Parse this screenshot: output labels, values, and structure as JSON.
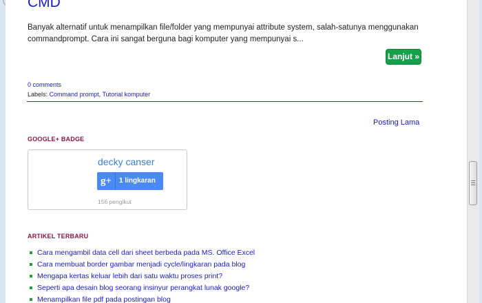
{
  "post": {
    "title": "CMD",
    "snippet": "Banyak alternatif untuk menampilkan file/folder yang mempunyai attribute system, salah-satunya menggunakan commandprompt. Cara ini sangat berguna bagi komputer yang mempunyai s...",
    "read_more": "Lanjut »",
    "comments": "0 comments",
    "labels_prefix": "Labels:",
    "labels": [
      "Command prompt",
      "Tutorial komputer"
    ],
    "label_separator": ","
  },
  "pager": {
    "older": "Posting Lama"
  },
  "gplus_widget": {
    "title": "GOOGLE+ BADGE",
    "name": "decky canser",
    "button_icon": "g+",
    "button_label": "1 lingkaran",
    "followers": "156 pengikut"
  },
  "recent_widget": {
    "title": "ARTIKEL TERBARU",
    "items": [
      "Cara mengambil data cell dari sheet berbeda pada MS. Office Excel",
      "Cara membuat border gambar menjadi cycle/lingkaran pada blog",
      "Mengapa kertas keluar lebih dari satu waktu proses print?",
      "Seperti apa desain blog seorang insinyur perangkat lunak google?",
      "Menampilkan file pdf pada postingan blog"
    ]
  },
  "colors": {
    "link": "#1a1acc",
    "widget_title": "#8b1747",
    "read_more_bg": "#17a04a",
    "gplus_blue": "#4a8af4",
    "bullet": "#1e9a44"
  }
}
